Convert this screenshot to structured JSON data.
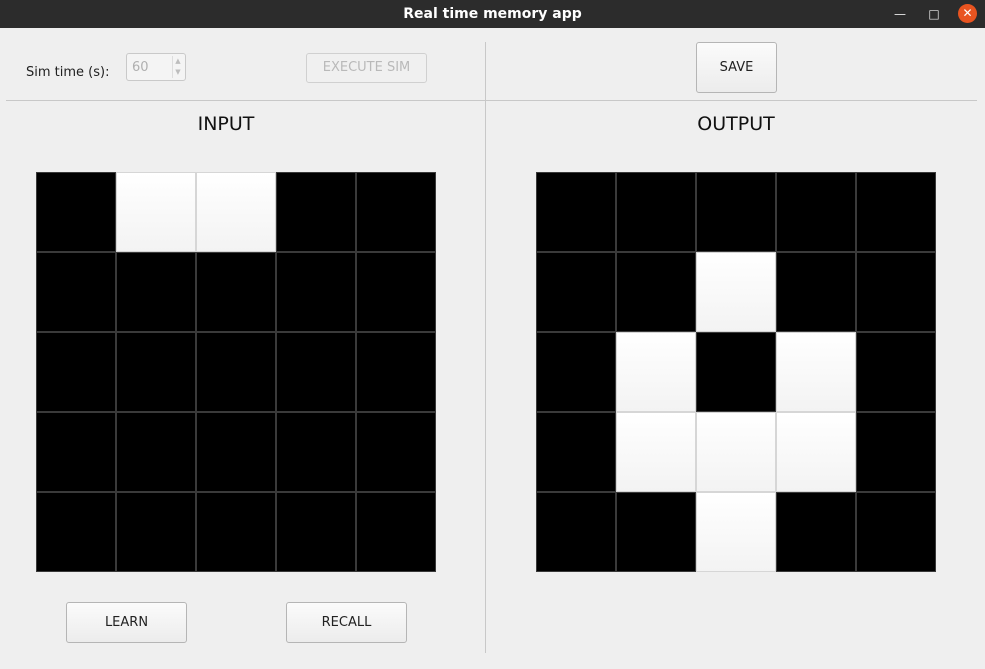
{
  "window": {
    "title": "Real time memory app",
    "controls": {
      "minimize": "—",
      "maximize": "□",
      "close": "✕"
    }
  },
  "toolbar": {
    "sim_time_label": "Sim time (s):",
    "sim_time_value": "60",
    "execute_label": "EXECUTE SIM",
    "save_label": "SAVE"
  },
  "input_panel": {
    "title": "INPUT",
    "grid": [
      [
        0,
        1,
        1,
        0,
        0
      ],
      [
        0,
        0,
        0,
        0,
        0
      ],
      [
        0,
        0,
        0,
        0,
        0
      ],
      [
        0,
        0,
        0,
        0,
        0
      ],
      [
        0,
        0,
        0,
        0,
        0
      ]
    ],
    "learn_label": "LEARN",
    "recall_label": "RECALL"
  },
  "output_panel": {
    "title": "OUTPUT",
    "grid": [
      [
        0,
        0,
        0,
        0,
        0
      ],
      [
        0,
        0,
        1,
        0,
        0
      ],
      [
        0,
        1,
        0,
        1,
        0
      ],
      [
        0,
        1,
        1,
        1,
        0
      ],
      [
        0,
        0,
        1,
        0,
        0
      ]
    ]
  },
  "colors": {
    "on": "#ffffff",
    "off": "#000000",
    "close_button": "#e95420"
  }
}
